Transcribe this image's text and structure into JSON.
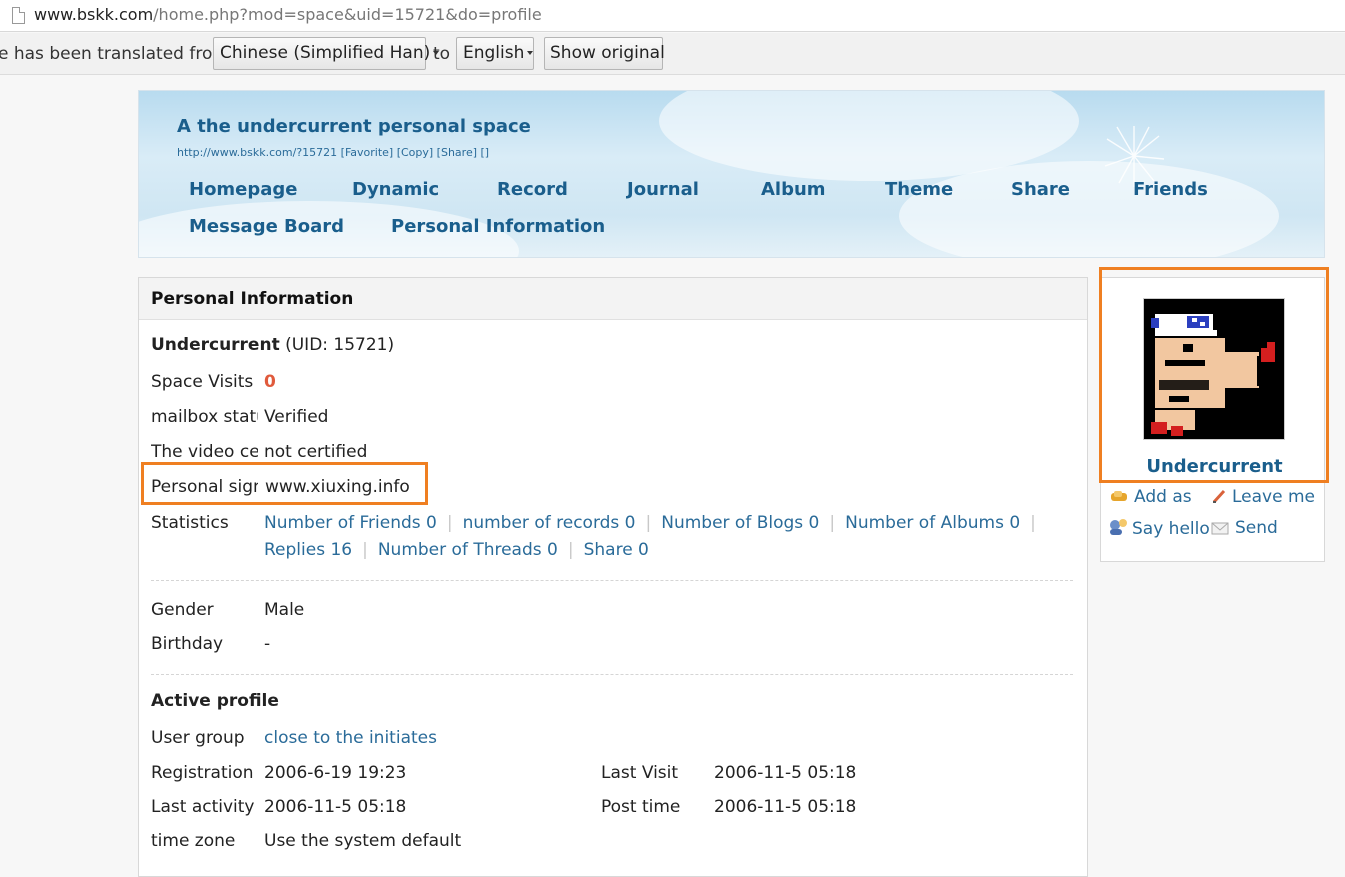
{
  "browser": {
    "url_host": "www.bskk.com",
    "url_path": "/home.php?mod=space&uid=15721&do=profile"
  },
  "translate_bar": {
    "prefix": "e has been translated from",
    "from_language": "Chinese (Simplified Han)",
    "to_word": "to",
    "to_language": "English",
    "show_original": "Show original"
  },
  "banner": {
    "title": "A the undercurrent personal space",
    "sublinks": "http://www.bskk.com/?15721 [Favorite] [Copy] [Share] []",
    "nav": [
      "Homepage",
      "Dynamic",
      "Record",
      "Journal",
      "Album",
      "Theme",
      "Share",
      "Friends",
      "Message Board",
      "Personal Information"
    ]
  },
  "profile": {
    "section_title": "Personal Information",
    "username": "Undercurrent",
    "uid_text": "(UID: 15721)",
    "space_visits_label": "Space Visits",
    "space_visits_value": "0",
    "mailbox_label": "mailbox status",
    "mailbox_value": "Verified",
    "video_label": "The video certification",
    "video_value": "not certified",
    "signature_label": "Personal signature",
    "signature_value": "www.xiuxing.info",
    "statistics_label": "Statistics",
    "stats": [
      "Number of Friends 0",
      "number of records 0",
      "Number of Blogs 0",
      "Number of Albums 0",
      "Replies 16",
      "Number of Threads 0",
      "Share 0"
    ],
    "gender_label": "Gender",
    "gender_value": "Male",
    "birthday_label": "Birthday",
    "birthday_value": "-",
    "active_title": "Active profile",
    "user_group_label": "User group",
    "user_group_value": "close to the initiates",
    "registration_label": "Registration time",
    "registration_value": "2006-6-19 19:23",
    "last_visit_label": "Last Visit",
    "last_visit_value": "2006-11-5 05:18",
    "last_activity_label": "Last activity time",
    "last_activity_value": "2006-11-5 05:18",
    "post_time_label": "Post time",
    "post_time_value": "2006-11-5 05:18",
    "timezone_label": "time zone",
    "timezone_value": "Use the system default"
  },
  "sidebar": {
    "username": "Undercurrent",
    "actions": [
      "Add as",
      "Leave me",
      "Say hello",
      "Send"
    ]
  },
  "colors": {
    "link": "#2a6b99",
    "title": "#1a5e8c",
    "highlight": "#ef7f21",
    "visits": "#e05a3c"
  }
}
